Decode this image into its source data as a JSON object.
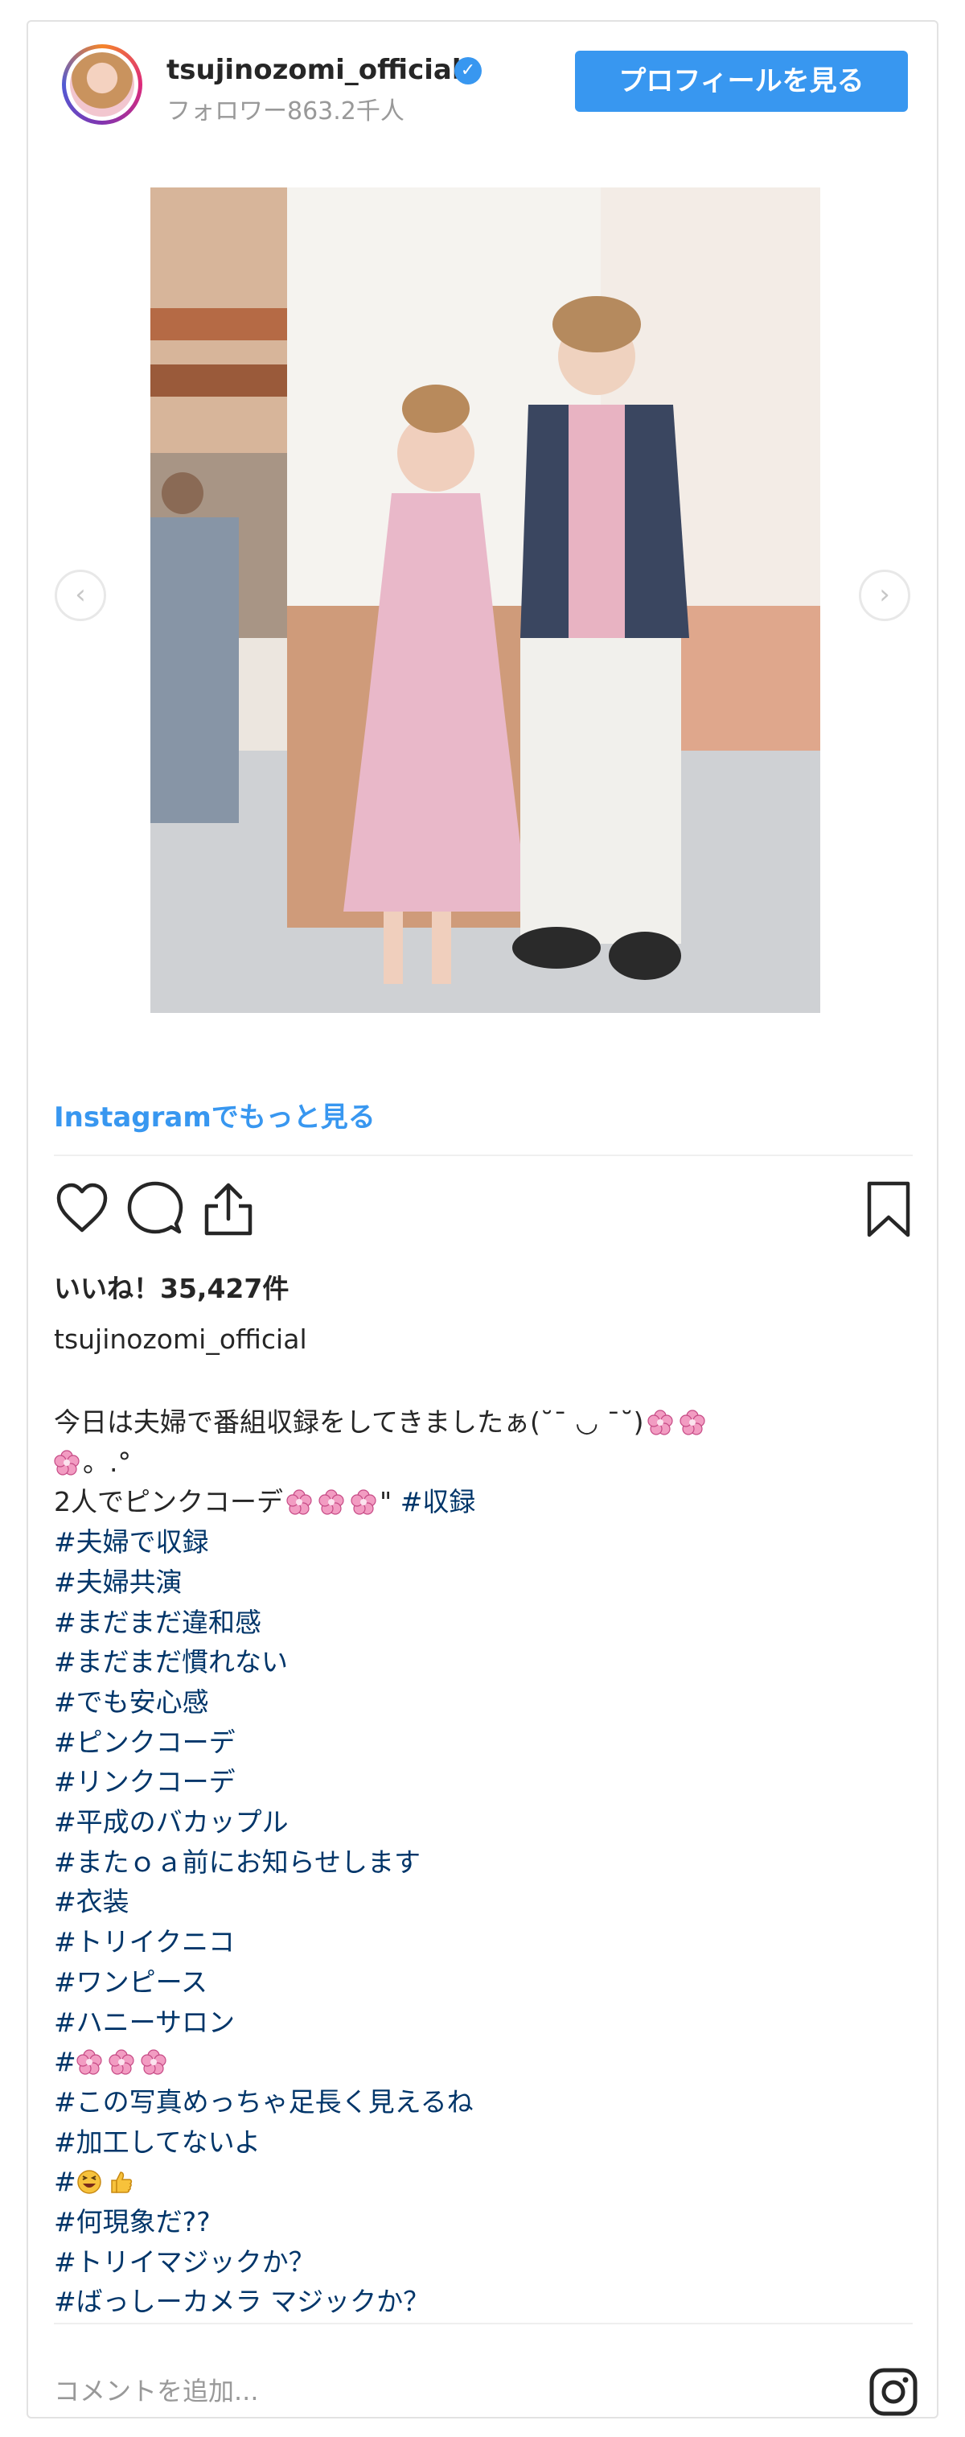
{
  "header": {
    "username": "tsujinozomi_official",
    "verified_icon": "verified-badge-icon",
    "followers": "フォロワー863.2千人",
    "profile_button": "プロフィールを見る"
  },
  "post": {
    "more_link": "Instagramでもっと見る",
    "likes": "いいね！35,427件",
    "author": "tsujinozomi_official"
  },
  "caption": {
    "line1": "今日は夫婦で番組収録をしてきましたぁ(˘¯ ◡ ¯˘)",
    "line2_tail": "。.°",
    "line3_text": "2人でピンクコーデ",
    "line3_quote": "\"",
    "line3_tag": "#収録",
    "tags": [
      "#夫婦で収録",
      "#夫婦共演",
      "#まだまだ違和感",
      "#まだまだ慣れない",
      "#でも安心感",
      "#ピンクコーデ",
      "#リンクコーデ",
      "#平成のバカップル",
      "#またｏａ前にお知らせします",
      "#衣装",
      "#トリイクニコ",
      "#ワンピース",
      "#ハニーサロン"
    ],
    "hash_flowers": "#",
    "tags2": [
      "#この写真めっちゃ足長く見えるね",
      "#加工してないよ"
    ],
    "hash_emoji": "#",
    "tags3": [
      "#何現象だ??",
      "#トリイマジックか？",
      "#ばっしーカメラ マジックか？"
    ]
  },
  "footer": {
    "comment_placeholder": "コメントを追加..."
  },
  "icons": {
    "heart": "heart-icon",
    "comment": "comment-icon",
    "share": "share-icon",
    "bookmark": "bookmark-icon",
    "instagram": "instagram-logo-icon",
    "prev": "chevron-left-icon",
    "next": "chevron-right-icon"
  },
  "colors": {
    "accent": "#3897f0",
    "hashtag": "#003569",
    "flower": "#e96aa6"
  }
}
